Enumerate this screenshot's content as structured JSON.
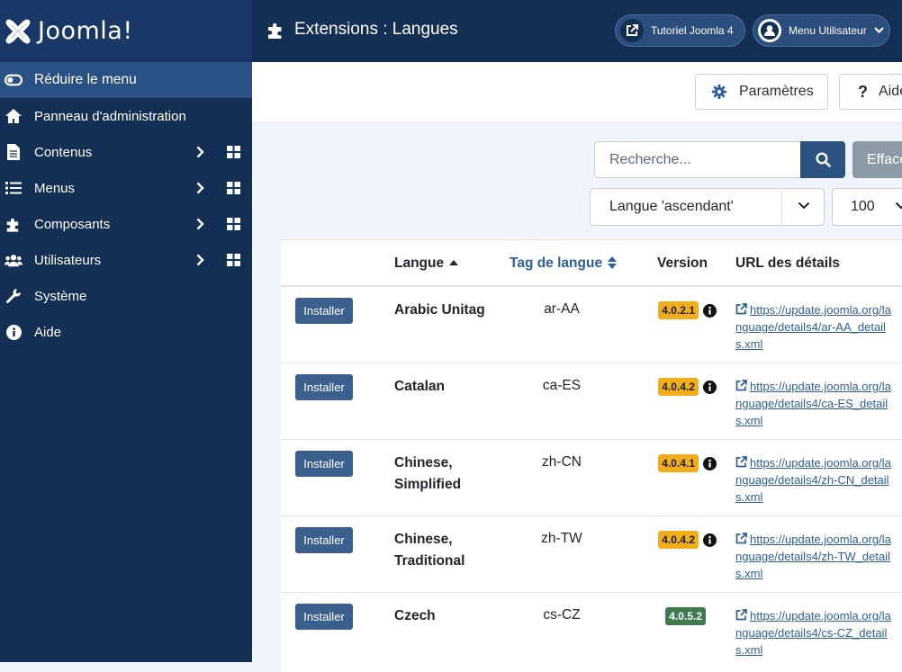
{
  "app": {
    "logo_text": "Joomla!",
    "page_title": "Extensions : Langues"
  },
  "header": {
    "tutorial_label": "Tutoriel Joomla 4",
    "user_menu_label": "Menu Utilisateur"
  },
  "sidebar": {
    "items": [
      {
        "label": "Réduire le menu",
        "icon": "toggle-icon"
      },
      {
        "label": "Panneau d'administration",
        "icon": "home-icon"
      },
      {
        "label": "Contenus",
        "icon": "file-icon"
      },
      {
        "label": "Menus",
        "icon": "list-icon"
      },
      {
        "label": "Composants",
        "icon": "puzzle-icon"
      },
      {
        "label": "Utilisateurs",
        "icon": "users-icon"
      },
      {
        "label": "Système",
        "icon": "wrench-icon"
      },
      {
        "label": "Aide",
        "icon": "info-icon"
      }
    ]
  },
  "toolbar": {
    "params_label": "Paramètres",
    "help_label": "Aide"
  },
  "filters": {
    "search_placeholder": "Recherche...",
    "clear_label": "Effacer",
    "sort_value": "Langue 'ascendant'",
    "limit_value": "100"
  },
  "table": {
    "headers": {
      "language": "Langue",
      "tag": "Tag de langue",
      "version": "Version",
      "url": "URL des détails"
    },
    "install_label": "Installer",
    "rows": [
      {
        "name": "Arabic Unitag",
        "tag": "ar-AA",
        "version": "4.0.2.1",
        "status": "outdated",
        "url": "https://update.joomla.org/language/details4/ar-AA_details.xml"
      },
      {
        "name": "Catalan",
        "tag": "ca-ES",
        "version": "4.0.4.2",
        "status": "outdated",
        "url": "https://update.joomla.org/language/details4/ca-ES_details.xml"
      },
      {
        "name": "Chinese, Simplified",
        "tag": "zh-CN",
        "version": "4.0.4.1",
        "status": "outdated",
        "url": "https://update.joomla.org/language/details4/zh-CN_details.xml"
      },
      {
        "name": "Chinese, Traditional",
        "tag": "zh-TW",
        "version": "4.0.4.2",
        "status": "outdated",
        "url": "https://update.joomla.org/language/details4/zh-TW_details.xml"
      },
      {
        "name": "Czech",
        "tag": "cs-CZ",
        "version": "4.0.5.2",
        "status": "current",
        "url": "https://update.joomla.org/language/details4/cs-CZ_details.xml"
      }
    ]
  },
  "colors": {
    "header_bg": "#132f53",
    "sidebar_active": "#2a5183",
    "badge_outdated": "#f2ad1b",
    "badge_current": "#3e7b4f",
    "link": "#2d5f9c"
  }
}
